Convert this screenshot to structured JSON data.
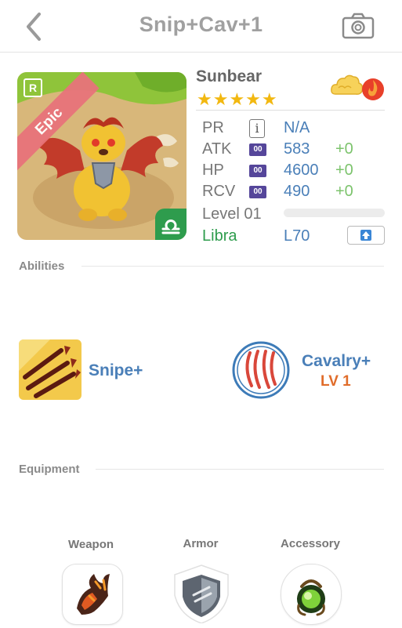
{
  "header": {
    "title": "Snip+Cav+1",
    "back_icon": "chevron-left-icon",
    "camera_icon": "camera-icon"
  },
  "hero": {
    "rarity_letter": "R",
    "rarity": "Epic",
    "name": "Sunbear",
    "stars": "★★★★★",
    "element_icons": [
      "cloud-icon",
      "fire-icon"
    ],
    "zodiac_symbol": "♎",
    "stats": [
      {
        "label": "PR",
        "value": "N/A",
        "bonus": ""
      },
      {
        "label": "ATK",
        "badge": "00",
        "value": "583",
        "bonus": "+0"
      },
      {
        "label": "HP",
        "badge": "00",
        "value": "4600",
        "bonus": "+0"
      },
      {
        "label": "RCV",
        "badge": "00",
        "value": "490",
        "bonus": "+0"
      }
    ],
    "level_label": "Level 01",
    "level_progress": 0,
    "zodiac": "Libra",
    "zodiac_level": "L70",
    "info_glyph": "i",
    "upgrade_icon": "arrow-up-icon"
  },
  "abilities": {
    "title": "Abilities",
    "items": [
      {
        "name": "Snipe+",
        "icon": "arrows-icon"
      },
      {
        "name": "Cavalry+",
        "level": "LV 1",
        "icon": "claw-icon"
      }
    ]
  },
  "equipment": {
    "title": "Equipment",
    "slots": [
      {
        "label": "Weapon",
        "icon": "claw-weapon-icon"
      },
      {
        "label": "Armor",
        "icon": "shield-armor-icon"
      },
      {
        "label": "Accessory",
        "icon": "orb-accessory-icon"
      }
    ]
  },
  "colors": {
    "accent_blue": "#4a7fb8",
    "bonus_green": "#7cc36c",
    "zodiac_green": "#2e9c4d",
    "level_orange": "#e06c2a",
    "star_gold": "#f2b810",
    "rarity_pink": "#e8737a"
  }
}
